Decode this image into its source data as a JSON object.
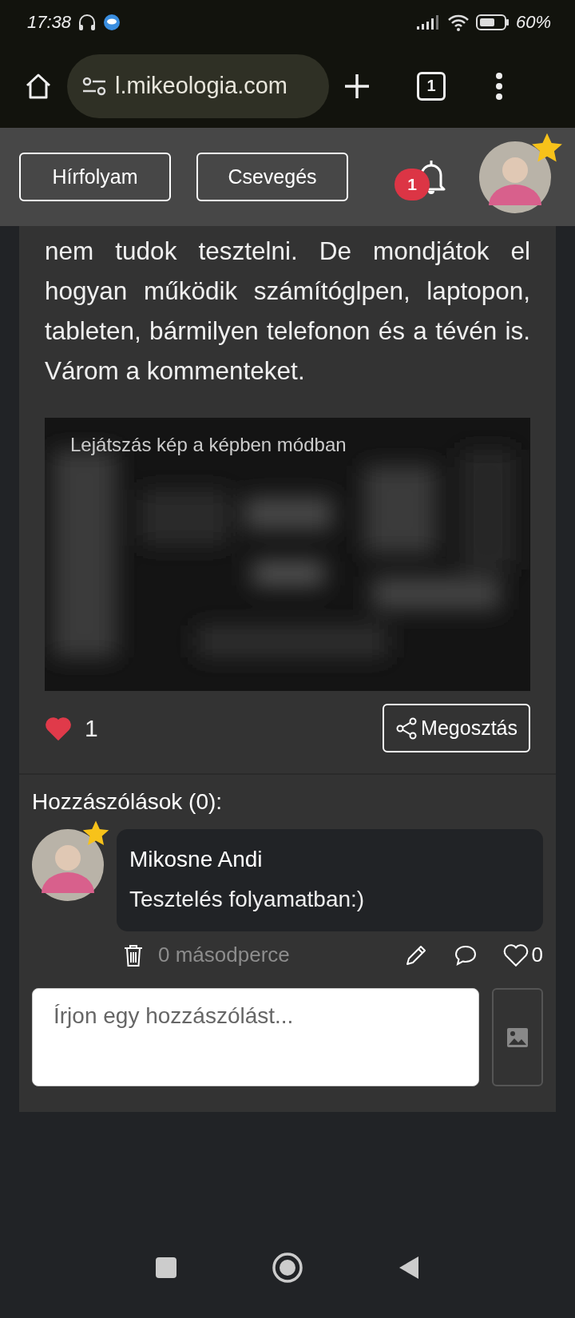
{
  "status_bar": {
    "time": "17:38",
    "battery": "60%"
  },
  "browser": {
    "url": "l.mikeologia.com",
    "tab_count": "1"
  },
  "header": {
    "nav_buttons": [
      "Hírfolyam",
      "Csevegés"
    ],
    "notification_count": "1"
  },
  "post": {
    "text": "nem tudok tesztelni. De mondjátok el hogyan működik számítóglpen, laptopon, tableten, bármilyen telefonon és a tévén is. Várom a kommenteket.",
    "video": {
      "caption": "Lejátszás kép a képben módban"
    },
    "liked": true,
    "like_count": "1",
    "share_label": "Megosztás"
  },
  "comments": {
    "heading": "Hozzászólások (0):",
    "items": [
      {
        "author": "Mikosne Andi",
        "text": "Tesztelés folyamatban:)",
        "time": "0 másodperce",
        "liked": false,
        "like_count": "0"
      }
    ],
    "input": {
      "placeholder": "Írjon egy hozzászólást..."
    }
  }
}
